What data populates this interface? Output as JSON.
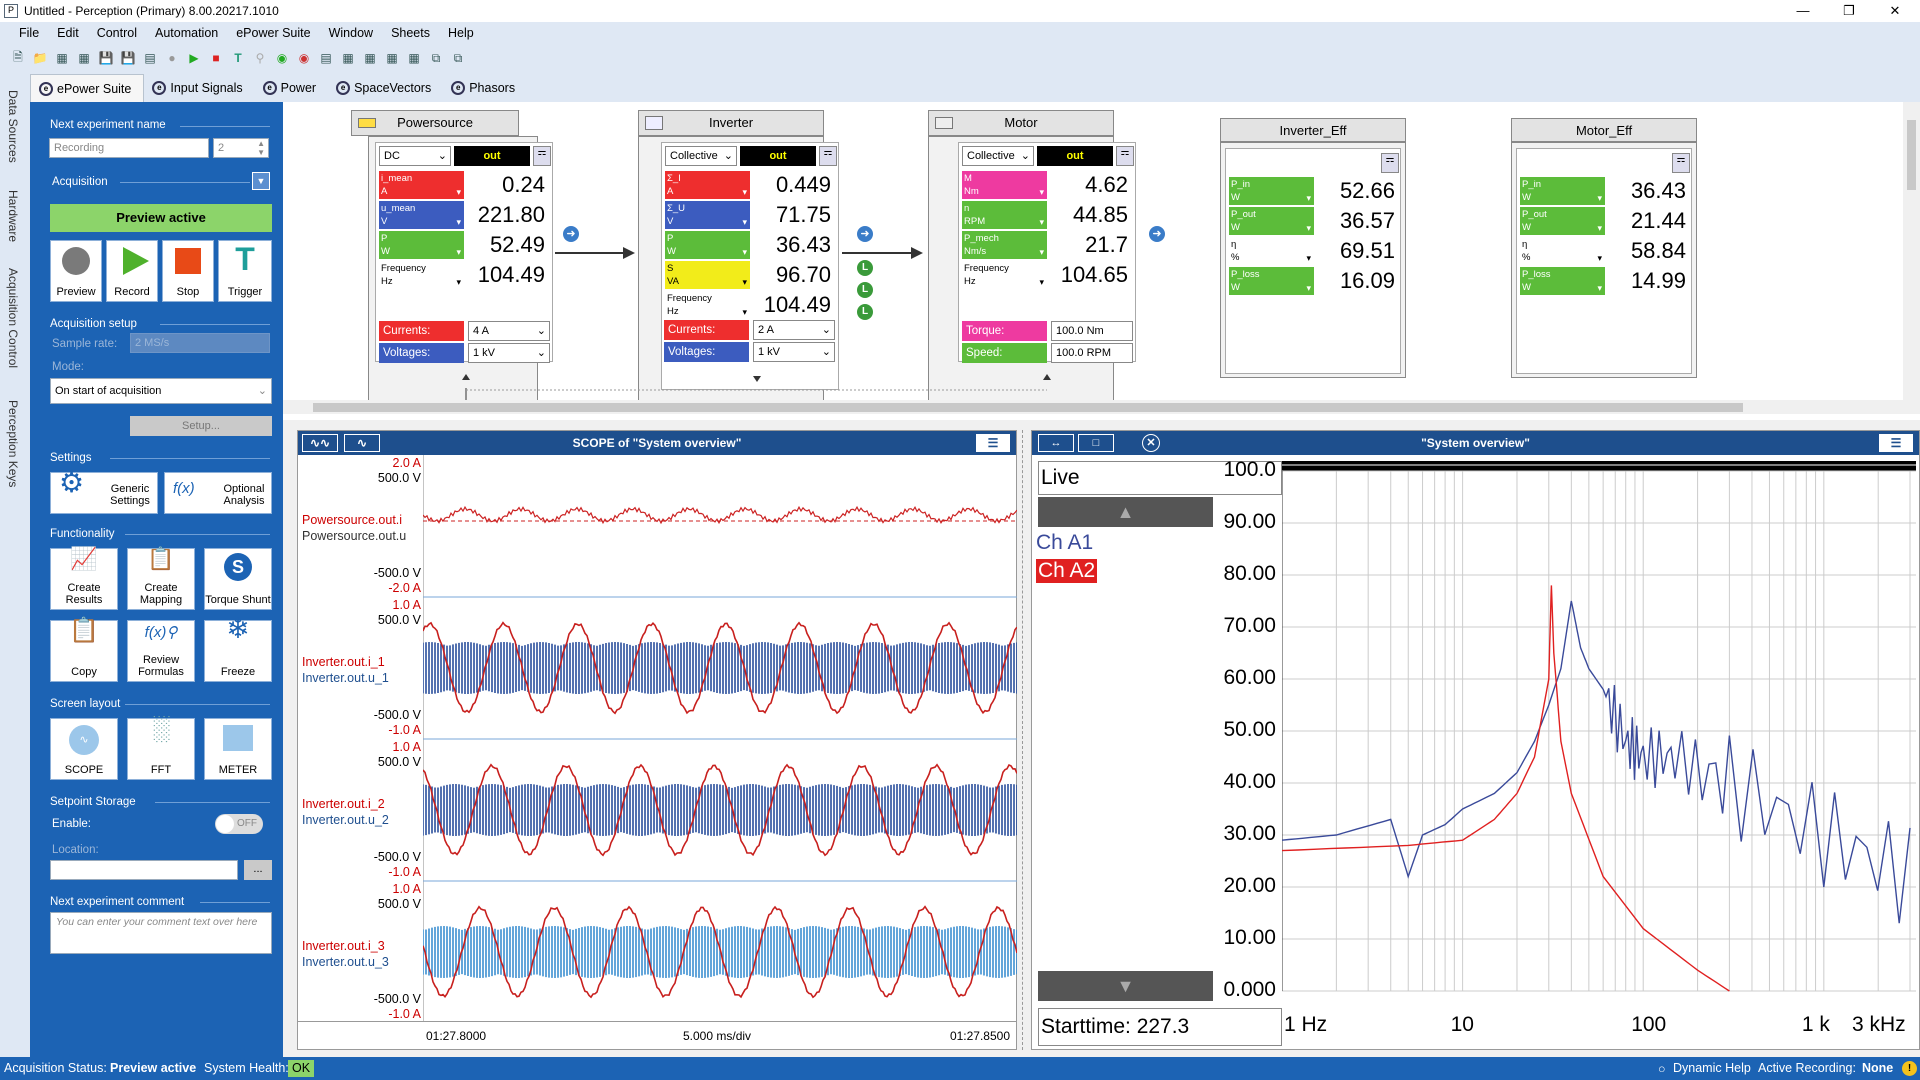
{
  "window": {
    "title": "Untitled - Perception (Primary) 8.00.20217.1010"
  },
  "menu": [
    "File",
    "Edit",
    "Control",
    "Automation",
    "ePower Suite",
    "Window",
    "Sheets",
    "Help"
  ],
  "tabs": [
    "ePower Suite",
    "Input Signals",
    "Power",
    "SpaceVectors",
    "Phasors"
  ],
  "side_tabs": [
    "Data Sources",
    "Hardware",
    "Acquisition Control",
    "Perception Keys"
  ],
  "left": {
    "next_name_label": "Next experiment name",
    "name_value": "Recording",
    "name_index": "2",
    "acquisition_label": "Acquisition",
    "preview_active": "Preview active",
    "buttons": {
      "preview": "Preview",
      "record": "Record",
      "stop": "Stop",
      "trigger": "Trigger"
    },
    "acq_setup": "Acquisition setup",
    "sample_rate_label": "Sample rate:",
    "sample_rate": "2 MS/s",
    "mode_label": "Mode:",
    "mode_value": "On start of acquisition",
    "setup": "Setup...",
    "settings": "Settings",
    "generic": "Generic Settings",
    "optional": "Optional Analysis",
    "functionality": "Functionality",
    "f_create_results": "Create Results",
    "f_create_mapping": "Create Mapping",
    "f_torque": "Torque Shunt",
    "f_copy": "Copy",
    "f_review": "Review Formulas",
    "f_freeze": "Freeze",
    "screen_layout": "Screen layout",
    "sl_scope": "SCOPE",
    "sl_fft": "FFT",
    "sl_meter": "METER",
    "setpoint": "Setpoint Storage",
    "enable": "Enable:",
    "off": "OFF",
    "location": "Location:",
    "browse": "...",
    "comment_label": "Next experiment comment",
    "comment_placeholder": "You can enter your comment text over here"
  },
  "blocks": {
    "powersource": {
      "title": "Powersource",
      "mode": "DC",
      "out": "out",
      "rows": [
        {
          "l": "i_mean",
          "u": "A",
          "v": "0.24",
          "c": "#ee2e2e"
        },
        {
          "l": "u_mean",
          "u": "V",
          "v": "221.80",
          "c": "#3c5cbf"
        },
        {
          "l": "P",
          "u": "W",
          "v": "52.49",
          "c": "#5cbc3a"
        },
        {
          "l": "Frequency",
          "u": "Hz",
          "v": "104.49",
          "c": "#ffffff"
        }
      ],
      "currents_label": "Currents:",
      "currents": "4 A",
      "voltages_label": "Voltages:",
      "voltages": "1 kV"
    },
    "inverter": {
      "title": "Inverter",
      "mode": "Collective",
      "out": "out",
      "rows": [
        {
          "l": "Σ_I",
          "u": "A",
          "v": "0.449",
          "c": "#ee2e2e"
        },
        {
          "l": "Σ_U",
          "u": "V",
          "v": "71.75",
          "c": "#3c5cbf"
        },
        {
          "l": "P",
          "u": "W",
          "v": "36.43",
          "c": "#5cbc3a"
        },
        {
          "l": "S",
          "u": "VA",
          "v": "96.70",
          "c": "#f2ec1a"
        },
        {
          "l": "Frequency",
          "u": "Hz",
          "v": "104.49",
          "c": "#ffffff"
        }
      ],
      "currents_label": "Currents:",
      "currents": "2 A",
      "voltages_label": "Voltages:",
      "voltages": "1 kV",
      "l_badges": [
        "L",
        "L",
        "L"
      ]
    },
    "motor": {
      "title": "Motor",
      "mode": "Collective",
      "out": "out",
      "rows": [
        {
          "l": "M",
          "u": "Nm",
          "v": "4.62",
          "c": "#ee3aa0"
        },
        {
          "l": "n",
          "u": "RPM",
          "v": "44.85",
          "c": "#5cbc3a"
        },
        {
          "l": "P_mech",
          "u": "Nm/s",
          "v": "21.7",
          "c": "#5cbc3a"
        },
        {
          "l": "Frequency",
          "u": "Hz",
          "v": "104.65",
          "c": "#ffffff"
        }
      ],
      "torque_label": "Torque:",
      "torque": "100.0 Nm",
      "speed_label": "Speed:",
      "speed": "100.0 RPM"
    },
    "inverter_eff": {
      "title": "Inverter_Eff",
      "rows": [
        {
          "l": "P_in",
          "u": "W",
          "v": "52.66",
          "c": "#5cbc3a"
        },
        {
          "l": "P_out",
          "u": "W",
          "v": "36.57",
          "c": "#5cbc3a"
        },
        {
          "l": "η",
          "u": "%",
          "v": "69.51",
          "c": "#ffffff"
        },
        {
          "l": "P_loss",
          "u": "W",
          "v": "16.09",
          "c": "#5cbc3a"
        }
      ]
    },
    "motor_eff": {
      "title": "Motor_Eff",
      "rows": [
        {
          "l": "P_in",
          "u": "W",
          "v": "36.43",
          "c": "#5cbc3a"
        },
        {
          "l": "P_out",
          "u": "W",
          "v": "21.44",
          "c": "#5cbc3a"
        },
        {
          "l": "η",
          "u": "%",
          "v": "58.84",
          "c": "#ffffff"
        },
        {
          "l": "P_loss",
          "u": "W",
          "v": "14.99",
          "c": "#5cbc3a"
        }
      ]
    }
  },
  "scope": {
    "title": "SCOPE of \"System overview\"",
    "panels": [
      {
        "top1": "2.0  A",
        "top2": "500.0  V",
        "n1": "Powersource.out.i",
        "n2": "Powersource.out.u",
        "b1": "-500.0  V",
        "b2": "-2.0  A"
      },
      {
        "top1": "1.0  A",
        "top2": "500.0  V",
        "n1": "Inverter.out.i_1",
        "n2": "Inverter.out.u_1",
        "b1": "-500.0  V",
        "b2": "-1.0  A"
      },
      {
        "top1": "1.0  A",
        "top2": "500.0  V",
        "n1": "Inverter.out.i_2",
        "n2": "Inverter.out.u_2",
        "b1": "-500.0  V",
        "b2": "-1.0  A"
      },
      {
        "top1": "1.0  A",
        "top2": "500.0  V",
        "n1": "Inverter.out.i_3",
        "n2": "Inverter.out.u_3",
        "b1": "-500.0  V",
        "b2": "-1.0  A"
      }
    ],
    "t_start": "01:27.8000",
    "t_div": "5.000 ms/div",
    "t_end": "01:27.8500"
  },
  "fft": {
    "title": "\"System overview\"",
    "live": "Live",
    "ch1": "Ch A1",
    "ch2": "Ch A2",
    "starttime": "Starttime: 227.3",
    "yticks": [
      "100.0",
      "90.00",
      "80.00",
      "70.00",
      "60.00",
      "50.00",
      "40.00",
      "30.00",
      "20.00",
      "10.00",
      "0.000"
    ],
    "xticks": [
      "1 Hz",
      "10",
      "100",
      "1 k",
      "3 kHz"
    ]
  },
  "chart_data": {
    "type": "line",
    "xlabel": "",
    "ylabel": "",
    "xscale": "log",
    "xlim": [
      1,
      3000
    ],
    "ylim": [
      0,
      100
    ],
    "series": [
      {
        "name": "Ch A1",
        "color": "#3a4a9a",
        "x": [
          1,
          2,
          4,
          5,
          6,
          8,
          10,
          15,
          20,
          25,
          30,
          35,
          40,
          45,
          50,
          60,
          80,
          100,
          150,
          300,
          1000,
          3000
        ],
        "y": [
          29,
          30,
          33,
          22,
          30,
          32,
          35,
          38,
          42,
          48,
          55,
          62,
          75,
          66,
          62,
          58,
          48,
          45,
          45,
          40,
          30,
          22
        ]
      },
      {
        "name": "Ch A2",
        "color": "#e02020",
        "x": [
          1,
          5,
          10,
          15,
          20,
          25,
          30,
          31,
          32,
          35,
          40,
          60,
          100,
          200,
          300
        ],
        "y": [
          27,
          28,
          29,
          33,
          38,
          45,
          60,
          78,
          65,
          48,
          38,
          22,
          12,
          4,
          0
        ]
      }
    ]
  },
  "status": {
    "acq_label": "Acquisition Status:",
    "acq": "Preview active",
    "health_label": "System Health:",
    "health": "OK",
    "help": "Dynamic Help",
    "rec_label": "Active Recording:",
    "rec": "None"
  }
}
